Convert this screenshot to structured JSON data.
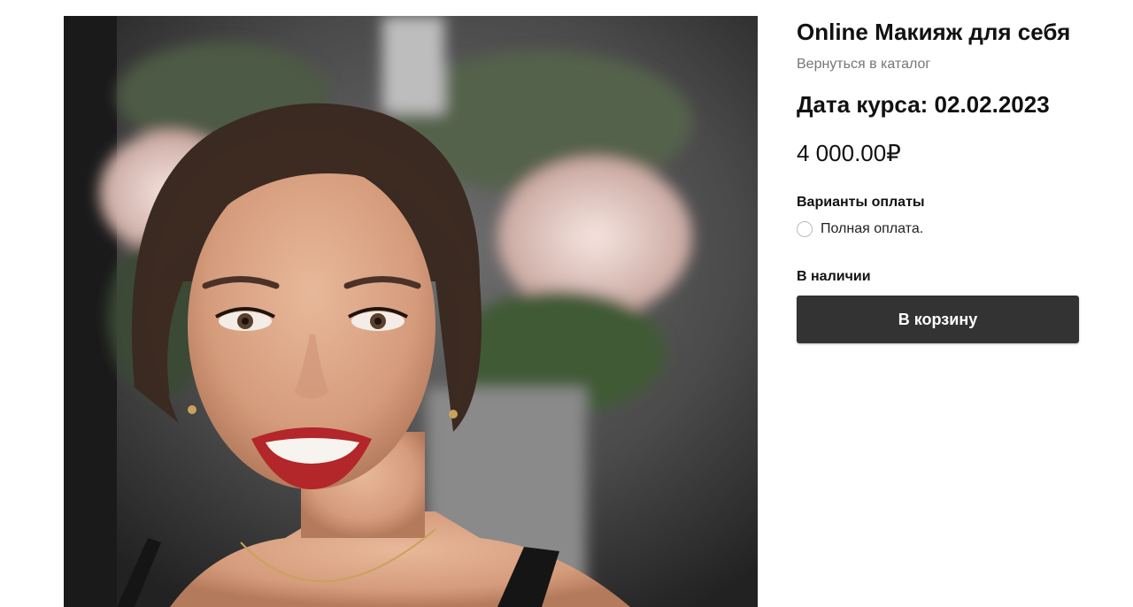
{
  "product": {
    "title": "Online Макияж для себя",
    "back_link": "Вернуться в каталог",
    "course_date": "Дата курса: 02.02.2023",
    "price": "4 000.00₽",
    "payment": {
      "label": "Варианты оплаты",
      "options": [
        {
          "label": "Полная оплата.",
          "selected": false
        }
      ]
    },
    "availability": "В наличии",
    "add_to_cart_label": "В корзину"
  },
  "colors": {
    "button_bg": "#333333",
    "link": "#777777"
  }
}
